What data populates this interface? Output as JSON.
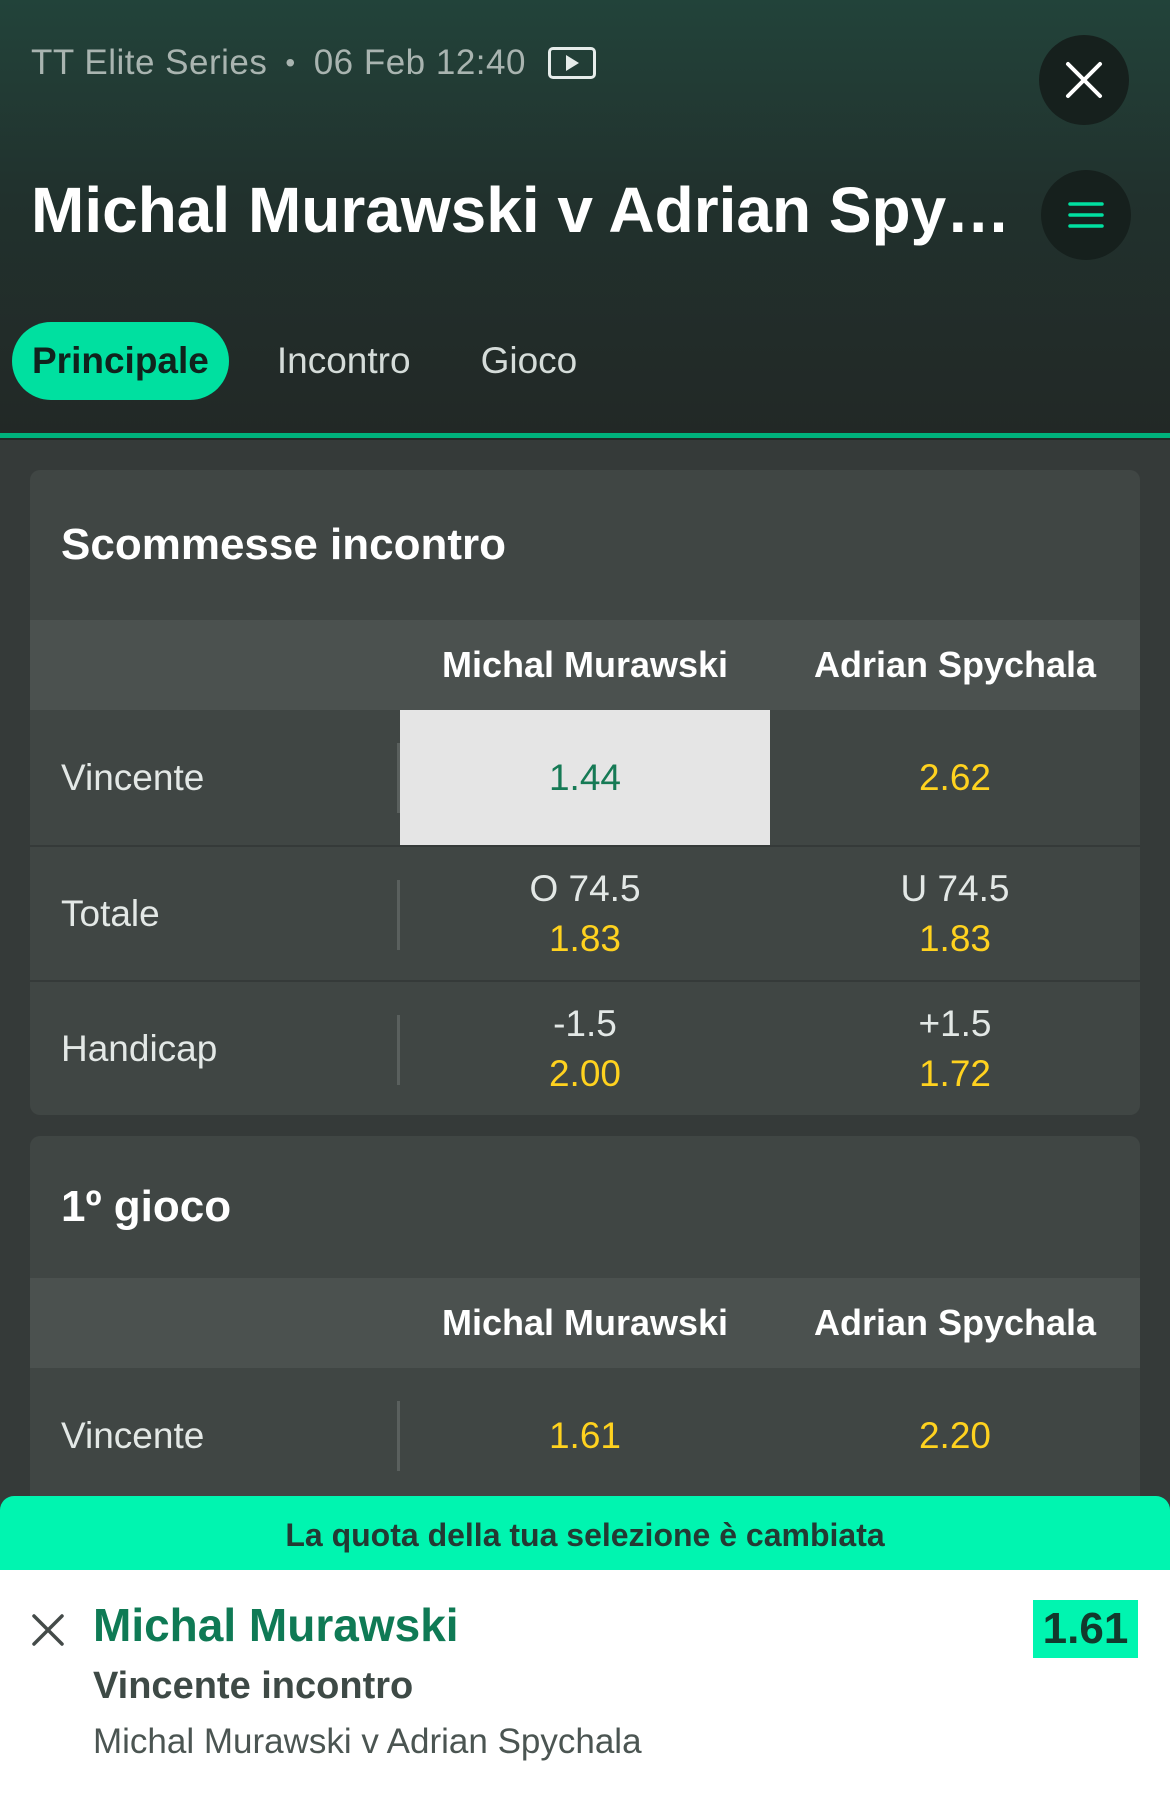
{
  "header": {
    "competition": "TT Elite Series",
    "separator": "•",
    "datetime": "06 Feb 12:40",
    "title": "Michal Murawski v Adrian Spychala",
    "icons": {
      "video": "video-play-icon",
      "close": "close-icon",
      "menu": "menu-icon"
    }
  },
  "tabs": [
    {
      "label": "Principale",
      "active": true
    },
    {
      "label": "Incontro",
      "active": false
    },
    {
      "label": "Gioco",
      "active": false
    }
  ],
  "match_bets": {
    "title": "Scommesse incontro",
    "columns": [
      "Michal Murawski",
      "Adrian Spychala"
    ],
    "rows": [
      {
        "label": "Vincente",
        "cells": [
          {
            "line": "",
            "odd": "1.44",
            "selected": true
          },
          {
            "line": "",
            "odd": "2.62"
          }
        ]
      },
      {
        "label": "Totale",
        "cells": [
          {
            "line": "O 74.5",
            "odd": "1.83"
          },
          {
            "line": "U 74.5",
            "odd": "1.83"
          }
        ]
      },
      {
        "label": "Handicap",
        "cells": [
          {
            "line": "-1.5",
            "odd": "2.00"
          },
          {
            "line": "+1.5",
            "odd": "1.72"
          }
        ]
      }
    ]
  },
  "first_game": {
    "title": "1º gioco",
    "columns": [
      "Michal Murawski",
      "Adrian Spychala"
    ],
    "rows": [
      {
        "label": "Vincente",
        "cells": [
          {
            "odd": "1.61"
          },
          {
            "odd": "2.20"
          }
        ]
      }
    ]
  },
  "notice": "La quota della tua selezione è cambiata",
  "betslip": {
    "selection": "Michal Murawski",
    "market": "Vincente incontro",
    "event": "Michal Murawski v Adrian Spychala",
    "odd": "1.61"
  },
  "colors": {
    "accent": "#00f5b0",
    "odds": "#ffd21f",
    "selected_bg": "#e5e5e5",
    "selected_text": "#167a55"
  }
}
